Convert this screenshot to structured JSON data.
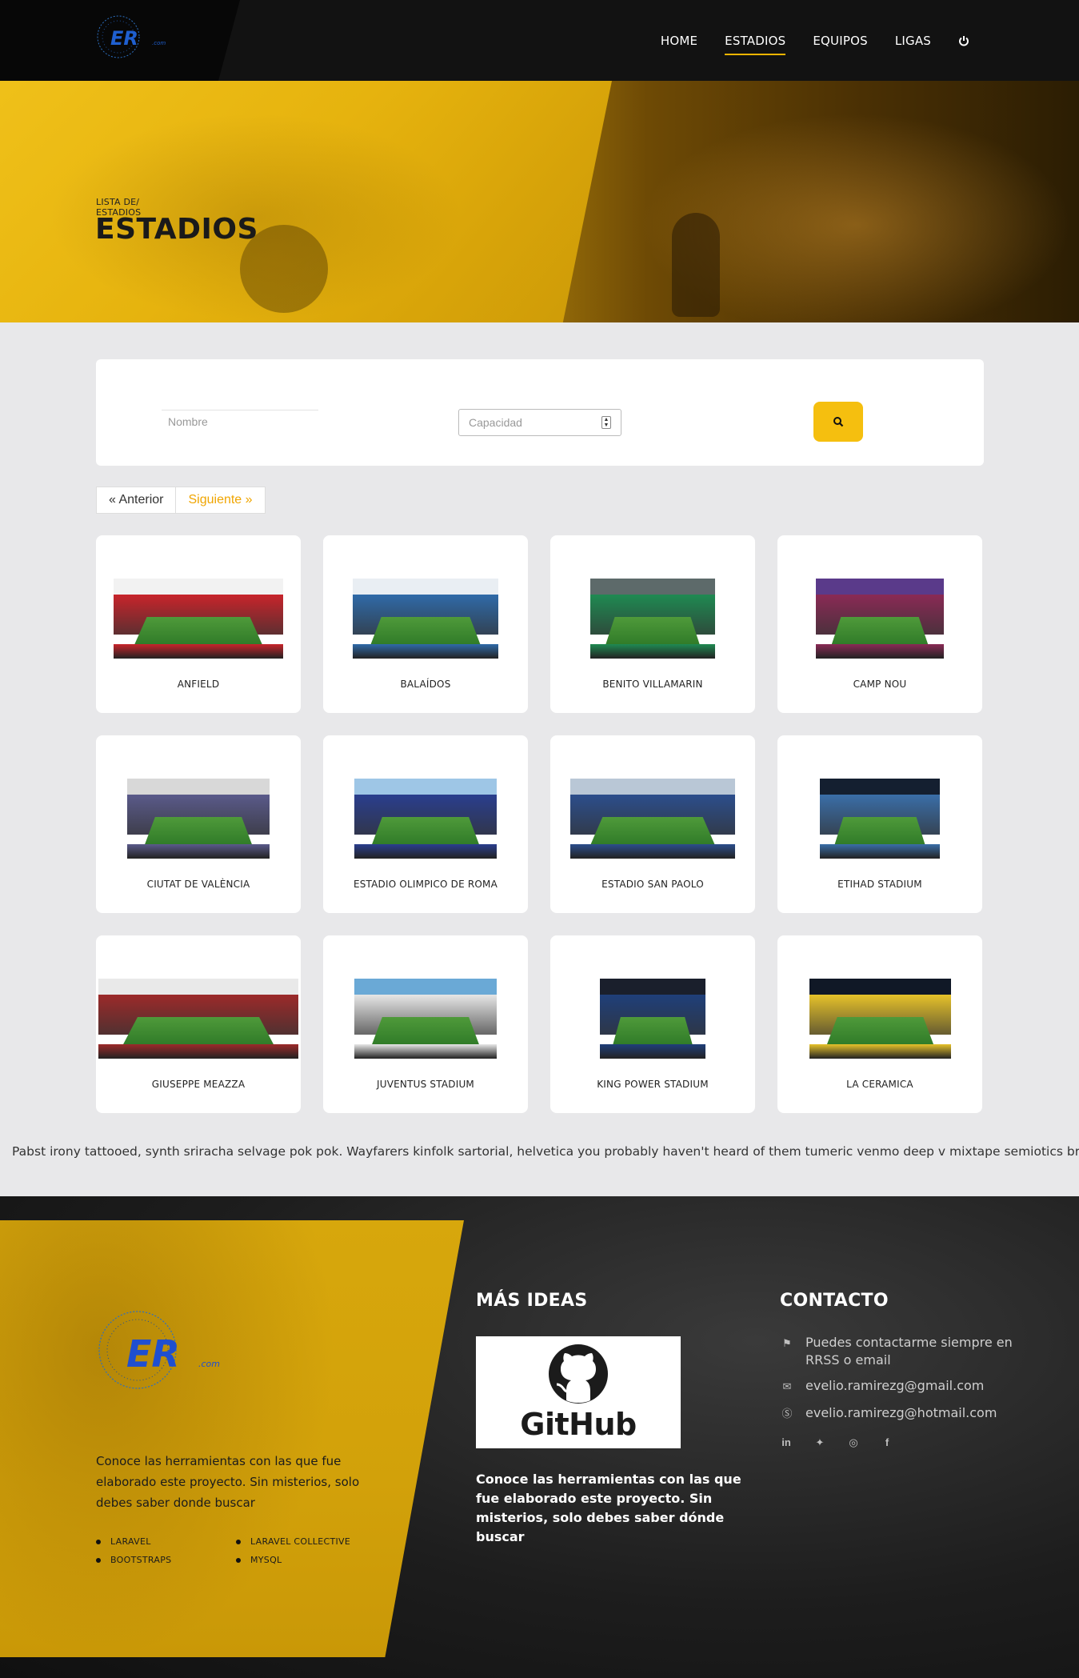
{
  "nav": {
    "logo_text": "ER",
    "logo_suffix": ".com",
    "links": [
      "HOME",
      "ESTADIOS",
      "EQUIPOS",
      "LIGAS"
    ],
    "active": "ESTADIOS",
    "power_icon": "power-icon"
  },
  "hero": {
    "breadcrumb": "LISTA DE/ ESTADIOS",
    "title": "ESTADIOS"
  },
  "search": {
    "nombre_placeholder": "Nombre",
    "capacidad_placeholder": "Capacidad",
    "button_icon": "search-icon"
  },
  "pager": {
    "prev": "« Anterior",
    "next": "Siguiente »"
  },
  "stadiums": [
    {
      "name": "ANFIELD",
      "stands": "#c8242b",
      "sky": "#f2f2f2"
    },
    {
      "name": "BALAÍDOS",
      "stands": "#2f6aa8",
      "sky": "#e9eef3"
    },
    {
      "name": "BENITO VILLAMARIN",
      "stands": "#1f8a52",
      "sky": "#5d6a6a"
    },
    {
      "name": "CAMP NOU",
      "stands": "#8a2a55",
      "sky": "#5a3a8a"
    },
    {
      "name": "CIUTAT DE VALÈNCIA",
      "stands": "#5a5a8a",
      "sky": "#d8d8d8"
    },
    {
      "name": "ESTADIO OLIMPICO DE ROMA",
      "stands": "#2a3e8e",
      "sky": "#9ec6e6"
    },
    {
      "name": "ESTADIO SAN PAOLO",
      "stands": "#2c4e8c",
      "sky": "#b9c7d6"
    },
    {
      "name": "ETIHAD STADIUM",
      "stands": "#3a6ea8",
      "sky": "#141f30"
    },
    {
      "name": "GIUSEPPE MEAZZA",
      "stands": "#9c2a2a",
      "sky": "#e9e9e9"
    },
    {
      "name": "JUVENTUS STADIUM",
      "stands": "#e6e6e6",
      "sky": "#6aa9d6"
    },
    {
      "name": "KING POWER STADIUM",
      "stands": "#1f3f7a",
      "sky": "#1a1f2c"
    },
    {
      "name": "LA CERAMICA",
      "stands": "#e6c22a",
      "sky": "#101826"
    }
  ],
  "lorem": "Pabst irony tattooed, synth sriracha selvage pok pok. Wayfarers kinfolk sartorial, helvetica you probably haven't heard of them tumeric venmo deep v mixtape semiotics brunch.",
  "footer": {
    "logo_text": "ER",
    "logo_suffix": ".com",
    "desc": "Conoce las herramientas con las que fue elaborado este proyecto. Sin misterios, solo debes saber donde buscar",
    "techs": [
      "LARAVEL",
      "LARAVEL COLLECTIVE",
      "BOOTSTRAPS",
      "MYSQL"
    ],
    "ideas_heading": "MÁS IDEAS",
    "github_word": "GitHub",
    "ideas_text": "Conoce las herramientas con las que fue elaborado este proyecto. Sin misterios, solo debes saber dónde buscar",
    "contact_heading": "CONTACTO",
    "contact": [
      {
        "icon": "flag-icon",
        "text": "Puedes contactarme siempre en RRSS o email"
      },
      {
        "icon": "envelope-icon",
        "text": "evelio.ramirezg@gmail.com"
      },
      {
        "icon": "skype-icon",
        "text": "evelio.ramirezg@hotmail.com"
      }
    ],
    "social": [
      "linkedin-icon",
      "twitter-icon",
      "instagram-icon",
      "facebook-icon"
    ]
  },
  "colors": {
    "accent": "#f5bf0f",
    "nav_bg": "#121212",
    "page_bg": "#e8e8ea"
  }
}
